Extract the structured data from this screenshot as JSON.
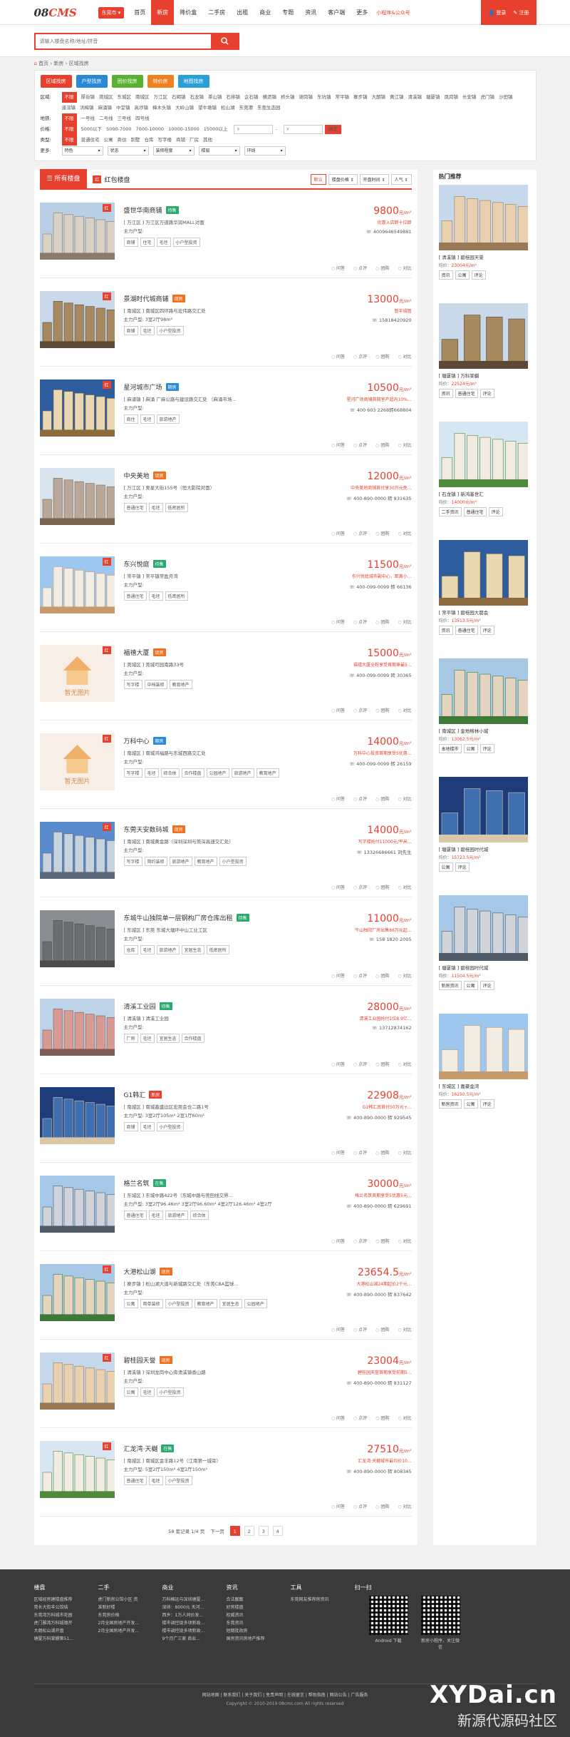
{
  "header": {
    "logo_main": "08",
    "logo_sub": "CMS",
    "city": "东莞市 ▾",
    "nav": [
      "首页",
      "新房",
      "降价盒",
      "二手房",
      "出租",
      "商业",
      "专题",
      "资讯",
      "客户端",
      "更多"
    ],
    "active_nav": 1,
    "mini_text": "小程序&公众号",
    "login": "登录",
    "register": "注册"
  },
  "search": {
    "placeholder": "请输入楼盘名称/地址/拼音"
  },
  "breadcrumb": "首页 › 新房 › 区域找房",
  "filter": {
    "tabs": [
      {
        "label": "区域找房",
        "color": "#e8402e"
      },
      {
        "label": "户型找房",
        "color": "#2a88d8"
      },
      {
        "label": "团价找房",
        "color": "#5ab030"
      },
      {
        "label": "特价房",
        "color": "#f08020"
      },
      {
        "label": "地图找房",
        "color": "#2a9fd8"
      }
    ],
    "region_label": "区域:",
    "regions": [
      "不限",
      "厚街镇",
      "莞城区",
      "东城区",
      "南城区",
      "万江区",
      "石碣镇",
      "石龙镇",
      "茶山镇",
      "石排镇",
      "企石镇",
      "横沥镇",
      "桥头镇",
      "谢岗镇",
      "东坑镇",
      "常平镇",
      "寮步镇",
      "大朗镇",
      "黄江镇",
      "清溪镇",
      "塘厦镇",
      "凤岗镇",
      "长安镇",
      "虎门镇",
      "沙田镇",
      "道滘镇",
      "洪梅镇",
      "麻涌镇",
      "中堂镇",
      "高埗镇",
      "樟木头镇",
      "大岭山镇",
      "望牛墩镇",
      "松山湖",
      "东莞港",
      "东莞生态园"
    ],
    "metro_label": "地铁:",
    "metro": [
      "不限",
      "一号线",
      "二号线",
      "三号线",
      "四号线"
    ],
    "price_label": "价格:",
    "prices": [
      "不限",
      "5000以下",
      "5000-7000",
      "7000-10000",
      "10000-15000",
      "15000以上"
    ],
    "price_unit_a": "¥",
    "price_unit_b": "¥",
    "price_ok": "确定",
    "type_label": "类型:",
    "types": [
      "不限",
      "普通住宅",
      "公寓",
      "商住",
      "别墅",
      "仓库",
      "写字楼",
      "商铺",
      "厂房",
      "其他"
    ],
    "more_label": "更多:",
    "selects": [
      "特色",
      "状态",
      "装修程度",
      "楼层",
      "环线"
    ]
  },
  "list": {
    "all_tab": "所有楼盘",
    "red_tab": "红包楼盘",
    "red_icon": "红",
    "sorts": [
      "默认",
      "楼盘价格 ⇕",
      "开盘时间 ⇕",
      "人气 ⇕"
    ],
    "actions": [
      "问答",
      "点评",
      "团购",
      "对比"
    ],
    "items": [
      {
        "name": "盛世华南商铺",
        "badge": "待售",
        "badge_color": "#2aaa6e",
        "addr": "[ 万江区 ] 万江区万道路华润MALL对面",
        "rooms": "主力户型:",
        "tags": [
          "商铺",
          "住宅",
          "毛坯",
          "小户型投资"
        ],
        "price": "9800",
        "unit": "元/m²",
        "promo": "优惠入店即十位即",
        "phone": "4009646549881",
        "hb": true,
        "img": 0
      },
      {
        "name": "景湖时代城商铺",
        "badge": "现房",
        "badge_color": "#f07020",
        "addr": "[ 南城区 ] 南城区四环路与宏伟路交汇处",
        "rooms": "主力户型: 3室2厅98m²",
        "tags": [
          "商铺",
          "毛坯",
          "小户型投资"
        ],
        "price": "13000",
        "unit": "元/m²",
        "promo": "暂半结团",
        "phone": "15818420920",
        "hb": true,
        "img": 1
      },
      {
        "name": "星河城市广场",
        "badge": "期房",
        "badge_color": "#2a88d8",
        "addr": "[ 麻涌镇 ] 麻涌 广麻公路与建设路交汇处 （麻涌市场...",
        "rooms": "主力户型:",
        "tags": [
          "商住",
          "毛坯",
          "旅游地产"
        ],
        "price": "10500",
        "unit": "元/m²",
        "promo": "星河广场商铺首期室产超内10%...",
        "phone": "400 603 2268转668804",
        "hb": true,
        "img": 2
      },
      {
        "name": "中央美地",
        "badge": "现房",
        "badge_color": "#f07020",
        "addr": "[ 万江区 ] 奥星大街155号（恒大影院对面）",
        "rooms": "主力户型:",
        "tags": [
          "普通住宅",
          "毛坯",
          "低密居所"
        ],
        "price": "12000",
        "unit": "元/m²",
        "promo": "中央美地商铺首付享30万元免...",
        "phone": "400-890-0000 转 831635",
        "hb": false,
        "img": 3
      },
      {
        "name": "东兴悦庭",
        "badge": "待售",
        "badge_color": "#2aaa6e",
        "addr": "[ 常平镇 ] 常平镇常盈月湾",
        "rooms": "主力户型:",
        "tags": [
          "普通住宅",
          "毛坯",
          "低密居所"
        ],
        "price": "11500",
        "unit": "元/m²",
        "promo": "东兴悦庭城市副中心，距离小...",
        "phone": "400-099-0099 转 66136",
        "hb": true,
        "img": 4
      },
      {
        "name": "福禧大厦",
        "badge": "现房",
        "badge_color": "#f07020",
        "addr": "[ 莞城区 ] 莞城可园南路33号",
        "rooms": "主力户型:",
        "tags": [
          "写字楼",
          "中档装修",
          "教育地产"
        ],
        "price": "15000",
        "unit": "元/m²",
        "promo": "福禧大厦全程享受首期奉最5...",
        "phone": "400-099-0099 转 30365",
        "hb": true,
        "img": -1
      },
      {
        "name": "万科中心",
        "badge": "期房",
        "badge_color": "#2a88d8",
        "addr": "[ 南城区 ] 南城鸿福路与东城西路交汇处",
        "rooms": "主力户型:",
        "tags": [
          "写字楼",
          "毛坯",
          "综合体",
          "合作楼盘",
          "公园地产",
          "旅游地产",
          "教育地产"
        ],
        "price": "14000",
        "unit": "元/m²",
        "promo": "万科中心投资首期享受5优惠...",
        "phone": "400-099-0099 转 26159",
        "hb": true,
        "img": -1
      },
      {
        "name": "东莞天安数码城",
        "badge": "现房",
        "badge_color": "#f07020",
        "addr": "[ 南城区 ] 南城黄金路（深圳深圳与莞深高速交汇处）",
        "rooms": "主力户型:",
        "tags": [
          "写字楼",
          "简约装修",
          "旅游地产",
          "教育地产",
          "小户型投资"
        ],
        "price": "14000",
        "unit": "元/m²",
        "promo": "写字楼抢付11000元/平米...",
        "phone": "13326686661 刘先生",
        "hb": true,
        "img": 5
      },
      {
        "name": "东城牛山独院单一层钢构厂房仓库出租",
        "badge": "待售",
        "badge_color": "#2aaa6e",
        "addr": "[ 东城区 ] 东莞 东城大塘环中山工业工区",
        "rooms": "主力户型:",
        "tags": [
          "仓库",
          "毛坯",
          "旅游地产",
          "宜居生态",
          "低密居所"
        ],
        "price": "11000",
        "unit": "元/m²",
        "promo": "牛山独院厂房出售86万元起...",
        "phone": "158 1820 2005",
        "hb": false,
        "img": 6
      },
      {
        "name": "清溪工业园",
        "badge": "待售",
        "badge_color": "#2aaa6e",
        "addr": "[ 清溪镇 ] 清溪工业园",
        "rooms": "主力户型:",
        "tags": [
          "厂房",
          "毛坯",
          "宜居生态",
          "合作楼盘"
        ],
        "price": "28000",
        "unit": "元/m²",
        "promo": "清溪工业园抢付1位8.9亿...",
        "phone": "13712874162",
        "hb": false,
        "img": 7
      },
      {
        "name": "G1韩汇",
        "badge": "新房",
        "badge_color": "#e8402e",
        "addr": "[ 南城区 ] 南城鑫盛边区宏莞会也二路1号",
        "rooms": "主力户型: 3室2厅105m²   2室1厅60m²",
        "tags": [
          "商铺",
          "毛坯",
          "小户型投资"
        ],
        "price": "22908",
        "unit": "元/m²",
        "promo": "G1韩汇底首付50万元+...",
        "phone": "400-890-0000 转 929545",
        "hb": false,
        "img": 8
      },
      {
        "name": "格兰名筑",
        "badge": "在售",
        "badge_color": "#2aaa6e",
        "addr": "[ 东城区 ] 东城中路422号（东城中路与莞田线交界...",
        "rooms": "主力户型: 3室2厅96.46m²  3室2厅96.60m²  4室2厅126.46m²  4室2厅",
        "tags": [
          "普通住宅",
          "毛坯",
          "旅游地产",
          "综合体"
        ],
        "price": "30000",
        "unit": "元/m²",
        "promo": "格兰名筑首期享受5优惠5元...",
        "phone": "400-890-0000 转 629691",
        "hb": false,
        "img": 9
      },
      {
        "name": "大港松山湖",
        "badge": "现房",
        "badge_color": "#f07020",
        "addr": "[ 寮步镇 ] 松山湖大道与新城路交汇处（东莞CBA篮球...",
        "rooms": "主力户型:",
        "tags": [
          "公寓",
          "简单装修",
          "小户型投资",
          "教育地产",
          "宜居生态",
          "公园地产"
        ],
        "price": "23654.5",
        "unit": "元/m²",
        "promo": "大港松山湖24期起价2千元...",
        "phone": "400-890-0000 转 837642",
        "hb": true,
        "img": 10
      },
      {
        "name": "碧桂园天誉",
        "badge": "现房",
        "badge_color": "#f07020",
        "addr": "[ 清溪镇 ] 深圳龙岗中心旁清溪镇香山路",
        "rooms": "主力户型:",
        "tags": [
          "公寓",
          "毛坯",
          "小户型投资"
        ],
        "price": "23004",
        "unit": "元/m²",
        "promo": "碧桂园天誉首期享受前期5...",
        "phone": "400-890-0000 转 831127",
        "hb": true,
        "img": 11
      },
      {
        "name": "汇龙湾·天樾",
        "badge": "在售",
        "badge_color": "#2aaa6e",
        "addr": "[ 南城区 ] 南城区金丰路12号（江南第一城旁）",
        "rooms": "主力户型: 5室2厅150m²   4室2厅150m²",
        "tags": [
          "普通住宅",
          "毛坯",
          "小户型投资"
        ],
        "price": "27510",
        "unit": "元/m²",
        "promo": "汇龙湾·天樾城市最均价10...",
        "phone": "400-890-0000 转 808345",
        "hb": true,
        "img": 12
      }
    ]
  },
  "pager": {
    "info": "58 套记录 1/4 页",
    "next": "下一页",
    "pages": [
      "1",
      "2",
      "3",
      "4"
    ]
  },
  "side": {
    "title": "热门推荐",
    "items": [
      {
        "name": "[ 清溪镇 ]  碧桂园天誉",
        "price": "23004",
        "tags": [
          "资讯",
          "公寓",
          "评论"
        ]
      },
      {
        "name": "[ 塘厦镇 ]  万科棠樾",
        "price": "22524",
        "tags": [
          "资讯",
          "普通住宅",
          "评论"
        ]
      },
      {
        "name": "[ 石龙镇 ]  新鸿基世汇",
        "price": "14000",
        "tags": [
          "二手资讯",
          "普通住宅",
          "评论"
        ]
      },
      {
        "name": "[ 常平镇 ]  碧桂园大都会",
        "price": "13513.5",
        "tags": [
          "资讯",
          "普通住宅",
          "评论"
        ]
      },
      {
        "name": "[ 南城区 ]  金地格林小城",
        "price": "13062.5",
        "tags": [
          "本地楼市",
          "公寓",
          "评论"
        ]
      },
      {
        "name": "[ 塘厦镇 ]  碧桂园时代城",
        "price": "15723.5",
        "tags": [
          "公寓",
          "评论"
        ]
      },
      {
        "name": "[ 塘厦镇 ]  碧桂园时代城",
        "price": "11504.5",
        "tags": [
          "新房资讯",
          "公寓",
          "评论"
        ]
      },
      {
        "name": "[ 东城区 ]  嘉豪金湾",
        "price": "16250.5",
        "tags": [
          "新房资讯",
          "公寓",
          "评论"
        ]
      }
    ],
    "price_prefix": "均价：",
    "price_unit": "元/m²"
  },
  "footer": {
    "cols": [
      {
        "title": "楼盘",
        "items": [
          "区域经房建楼盘推荐",
          "莞长大街丰公馆结",
          "东莞湾万科城市花园",
          "虎门雅湾万科城镇开",
          "大朗松山湖开盘",
          "塘厦万科棠樾第51..."
        ]
      },
      {
        "title": "二手",
        "items": [
          "虎门新房公馆小区 资",
          "准新好楼",
          "东莞房价格",
          "2月全国房地产开发...",
          "2月全国房地产开发...",
          ""
        ]
      },
      {
        "title": "商业",
        "items": [
          "万科棉远与深圳塘厦...",
          "深圳：8000元 天河...",
          "西乡：1万人同价发...",
          "楼市调控现多项新政...",
          "楼市调控现多项新政...",
          "9个月广三家 商业..."
        ]
      },
      {
        "title": "资讯",
        "items": [
          "合法靓靓",
          "好房楼盘",
          "权威资讯",
          "东莞资讯",
          "短期批改房",
          "国房资讯房地产推荐"
        ]
      },
      {
        "title": "工具",
        "items": [
          "东莞网友推荐房资讯",
          "",
          "",
          "",
          "",
          ""
        ]
      }
    ],
    "qr_title": "扫一扫",
    "qr": [
      "Android 下载",
      "新房小程序，关注微信"
    ],
    "links": "网站地图  |  联系我们  |  关于我们  |  免责声明  |  在线留言  |  帮助指南  |  网站公告  |  广告服务",
    "copyright": "Copyright © 2010-2019 08cms.com All rights reserved",
    "wm_a": "XYDai.cn",
    "wm_b": "新源代源码社区"
  },
  "placeholder_text": "暂无图片",
  "colors": {
    "accent": "#e8402e"
  }
}
